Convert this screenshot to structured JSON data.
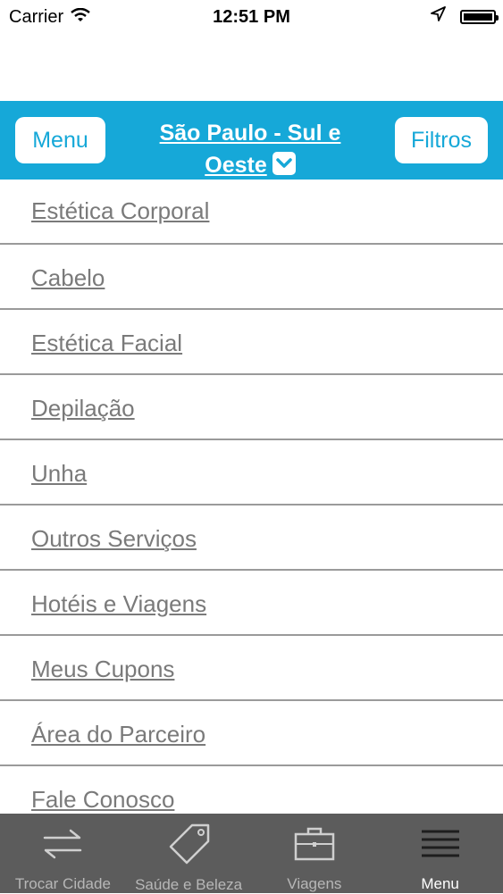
{
  "status_bar": {
    "carrier": "Carrier",
    "time": "12:51 PM"
  },
  "navbar": {
    "menu_label": "Menu",
    "title": "São Paulo - Sul e Oeste",
    "filters_label": "Filtros",
    "accent_color": "#16a8d8"
  },
  "menu": {
    "items": [
      "Estética Corporal",
      "Cabelo",
      "Estética Facial",
      "Depilação",
      "Unha",
      "Outros Serviços",
      "Hotéis e Viagens",
      "Meus Cupons",
      "Área do Parceiro",
      "Fale Conosco"
    ]
  },
  "tabbar": {
    "tabs": [
      {
        "label": "Trocar Cidade",
        "icon": "swap-arrows-icon"
      },
      {
        "label": "Saúde e Beleza",
        "icon": "tag-icon"
      },
      {
        "label": "Viagens",
        "icon": "briefcase-icon"
      },
      {
        "label": "Menu",
        "icon": "hamburger-icon",
        "active": true
      }
    ]
  }
}
